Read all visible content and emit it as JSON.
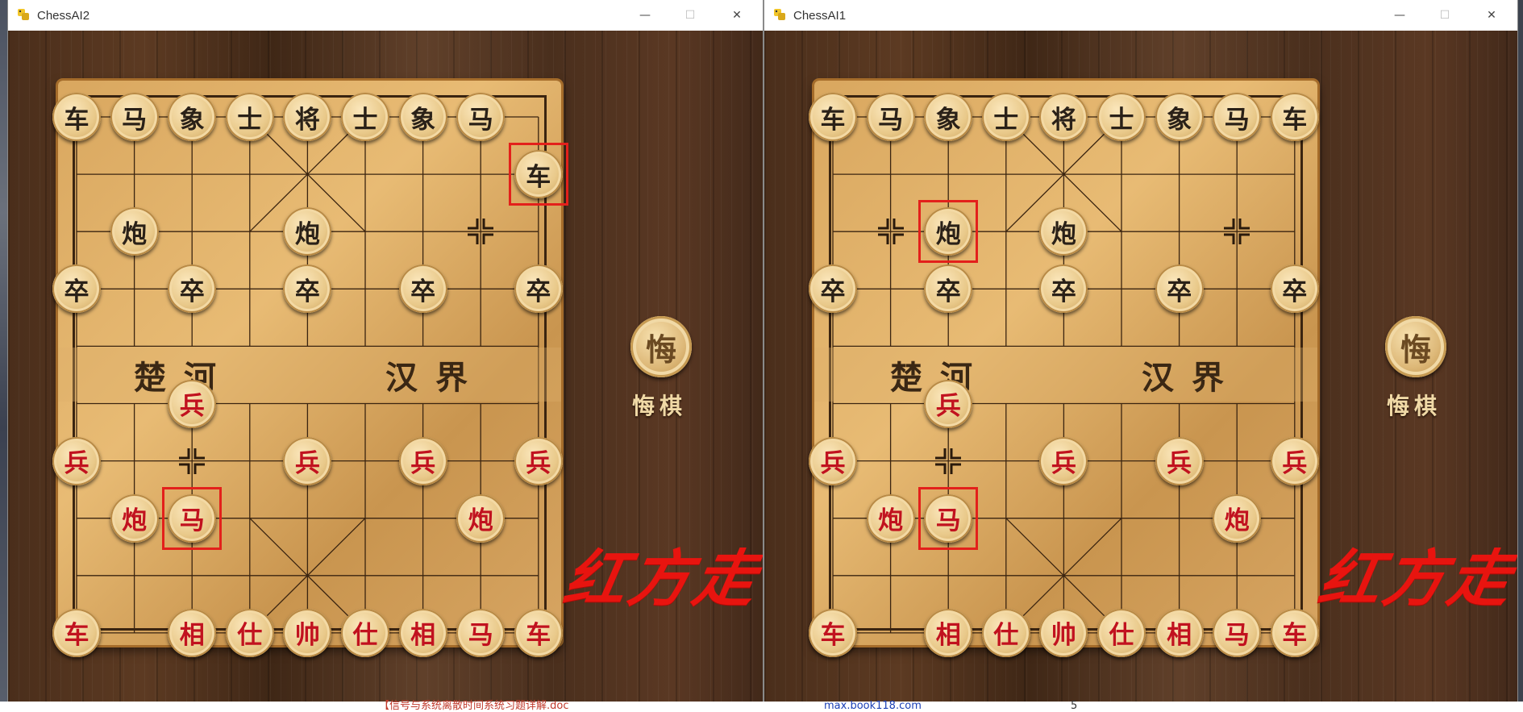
{
  "bottom_bar": {
    "left_text": "【信号与系统离散时间系统习题详解.doc",
    "right_text": "max.book118.com",
    "page_num": "5"
  },
  "windows": [
    {
      "title": "ChessAI2",
      "buttons": {
        "minimize": "—",
        "maximize": "☐",
        "close": "✕"
      },
      "river": {
        "left": "楚河",
        "right": "汉界"
      },
      "regret": {
        "button_glyph": "悔",
        "label": "悔棋"
      },
      "turn_text": "红方走",
      "pieces": [
        {
          "c": 0,
          "r": 0,
          "t": "车",
          "side": "black"
        },
        {
          "c": 1,
          "r": 0,
          "t": "马",
          "side": "black"
        },
        {
          "c": 2,
          "r": 0,
          "t": "象",
          "side": "black"
        },
        {
          "c": 3,
          "r": 0,
          "t": "士",
          "side": "black"
        },
        {
          "c": 4,
          "r": 0,
          "t": "将",
          "side": "black"
        },
        {
          "c": 5,
          "r": 0,
          "t": "士",
          "side": "black"
        },
        {
          "c": 6,
          "r": 0,
          "t": "象",
          "side": "black"
        },
        {
          "c": 7,
          "r": 0,
          "t": "马",
          "side": "black"
        },
        {
          "c": 8,
          "r": 1,
          "t": "车",
          "side": "black"
        },
        {
          "c": 1,
          "r": 2,
          "t": "炮",
          "side": "black"
        },
        {
          "c": 4,
          "r": 2,
          "t": "炮",
          "side": "black"
        },
        {
          "c": 0,
          "r": 3,
          "t": "卒",
          "side": "black"
        },
        {
          "c": 2,
          "r": 3,
          "t": "卒",
          "side": "black"
        },
        {
          "c": 4,
          "r": 3,
          "t": "卒",
          "side": "black"
        },
        {
          "c": 6,
          "r": 3,
          "t": "卒",
          "side": "black"
        },
        {
          "c": 8,
          "r": 3,
          "t": "卒",
          "side": "black"
        },
        {
          "c": 2,
          "r": 5,
          "t": "兵",
          "side": "red"
        },
        {
          "c": 0,
          "r": 6,
          "t": "兵",
          "side": "red"
        },
        {
          "c": 4,
          "r": 6,
          "t": "兵",
          "side": "red"
        },
        {
          "c": 6,
          "r": 6,
          "t": "兵",
          "side": "red"
        },
        {
          "c": 8,
          "r": 6,
          "t": "兵",
          "side": "red"
        },
        {
          "c": 1,
          "r": 7,
          "t": "炮",
          "side": "red"
        },
        {
          "c": 2,
          "r": 7,
          "t": "马",
          "side": "red"
        },
        {
          "c": 7,
          "r": 7,
          "t": "炮",
          "side": "red"
        },
        {
          "c": 0,
          "r": 9,
          "t": "车",
          "side": "red"
        },
        {
          "c": 2,
          "r": 9,
          "t": "相",
          "side": "red"
        },
        {
          "c": 3,
          "r": 9,
          "t": "仕",
          "side": "red"
        },
        {
          "c": 4,
          "r": 9,
          "t": "帅",
          "side": "red"
        },
        {
          "c": 5,
          "r": 9,
          "t": "仕",
          "side": "red"
        },
        {
          "c": 6,
          "r": 9,
          "t": "相",
          "side": "red"
        },
        {
          "c": 7,
          "r": 9,
          "t": "马",
          "side": "red"
        },
        {
          "c": 8,
          "r": 9,
          "t": "车",
          "side": "red"
        }
      ],
      "selections": [
        {
          "c": 8,
          "r": 1
        },
        {
          "c": 2,
          "r": 7
        }
      ],
      "hints": [
        {
          "c": 7,
          "r": 2
        },
        {
          "c": 2,
          "r": 6
        }
      ]
    },
    {
      "title": "ChessAI1",
      "buttons": {
        "minimize": "—",
        "maximize": "☐",
        "close": "✕"
      },
      "river": {
        "left": "楚河",
        "right": "汉界"
      },
      "regret": {
        "button_glyph": "悔",
        "label": "悔棋"
      },
      "turn_text": "红方走",
      "pieces": [
        {
          "c": 0,
          "r": 0,
          "t": "车",
          "side": "black"
        },
        {
          "c": 1,
          "r": 0,
          "t": "马",
          "side": "black"
        },
        {
          "c": 2,
          "r": 0,
          "t": "象",
          "side": "black"
        },
        {
          "c": 3,
          "r": 0,
          "t": "士",
          "side": "black"
        },
        {
          "c": 4,
          "r": 0,
          "t": "将",
          "side": "black"
        },
        {
          "c": 5,
          "r": 0,
          "t": "士",
          "side": "black"
        },
        {
          "c": 6,
          "r": 0,
          "t": "象",
          "side": "black"
        },
        {
          "c": 7,
          "r": 0,
          "t": "马",
          "side": "black"
        },
        {
          "c": 8,
          "r": 0,
          "t": "车",
          "side": "black"
        },
        {
          "c": 2,
          "r": 2,
          "t": "炮",
          "side": "black"
        },
        {
          "c": 4,
          "r": 2,
          "t": "炮",
          "side": "black"
        },
        {
          "c": 0,
          "r": 3,
          "t": "卒",
          "side": "black"
        },
        {
          "c": 2,
          "r": 3,
          "t": "卒",
          "side": "black"
        },
        {
          "c": 4,
          "r": 3,
          "t": "卒",
          "side": "black"
        },
        {
          "c": 6,
          "r": 3,
          "t": "卒",
          "side": "black"
        },
        {
          "c": 8,
          "r": 3,
          "t": "卒",
          "side": "black"
        },
        {
          "c": 2,
          "r": 5,
          "t": "兵",
          "side": "red"
        },
        {
          "c": 0,
          "r": 6,
          "t": "兵",
          "side": "red"
        },
        {
          "c": 4,
          "r": 6,
          "t": "兵",
          "side": "red"
        },
        {
          "c": 6,
          "r": 6,
          "t": "兵",
          "side": "red"
        },
        {
          "c": 8,
          "r": 6,
          "t": "兵",
          "side": "red"
        },
        {
          "c": 1,
          "r": 7,
          "t": "炮",
          "side": "red"
        },
        {
          "c": 2,
          "r": 7,
          "t": "马",
          "side": "red"
        },
        {
          "c": 7,
          "r": 7,
          "t": "炮",
          "side": "red"
        },
        {
          "c": 0,
          "r": 9,
          "t": "车",
          "side": "red"
        },
        {
          "c": 2,
          "r": 9,
          "t": "相",
          "side": "red"
        },
        {
          "c": 3,
          "r": 9,
          "t": "仕",
          "side": "red"
        },
        {
          "c": 4,
          "r": 9,
          "t": "帅",
          "side": "red"
        },
        {
          "c": 5,
          "r": 9,
          "t": "仕",
          "side": "red"
        },
        {
          "c": 6,
          "r": 9,
          "t": "相",
          "side": "red"
        },
        {
          "c": 7,
          "r": 9,
          "t": "马",
          "side": "red"
        },
        {
          "c": 8,
          "r": 9,
          "t": "车",
          "side": "red"
        }
      ],
      "selections": [
        {
          "c": 2,
          "r": 2
        },
        {
          "c": 2,
          "r": 7
        }
      ],
      "hints": [
        {
          "c": 1,
          "r": 2
        },
        {
          "c": 7,
          "r": 2
        },
        {
          "c": 2,
          "r": 6
        }
      ]
    }
  ]
}
